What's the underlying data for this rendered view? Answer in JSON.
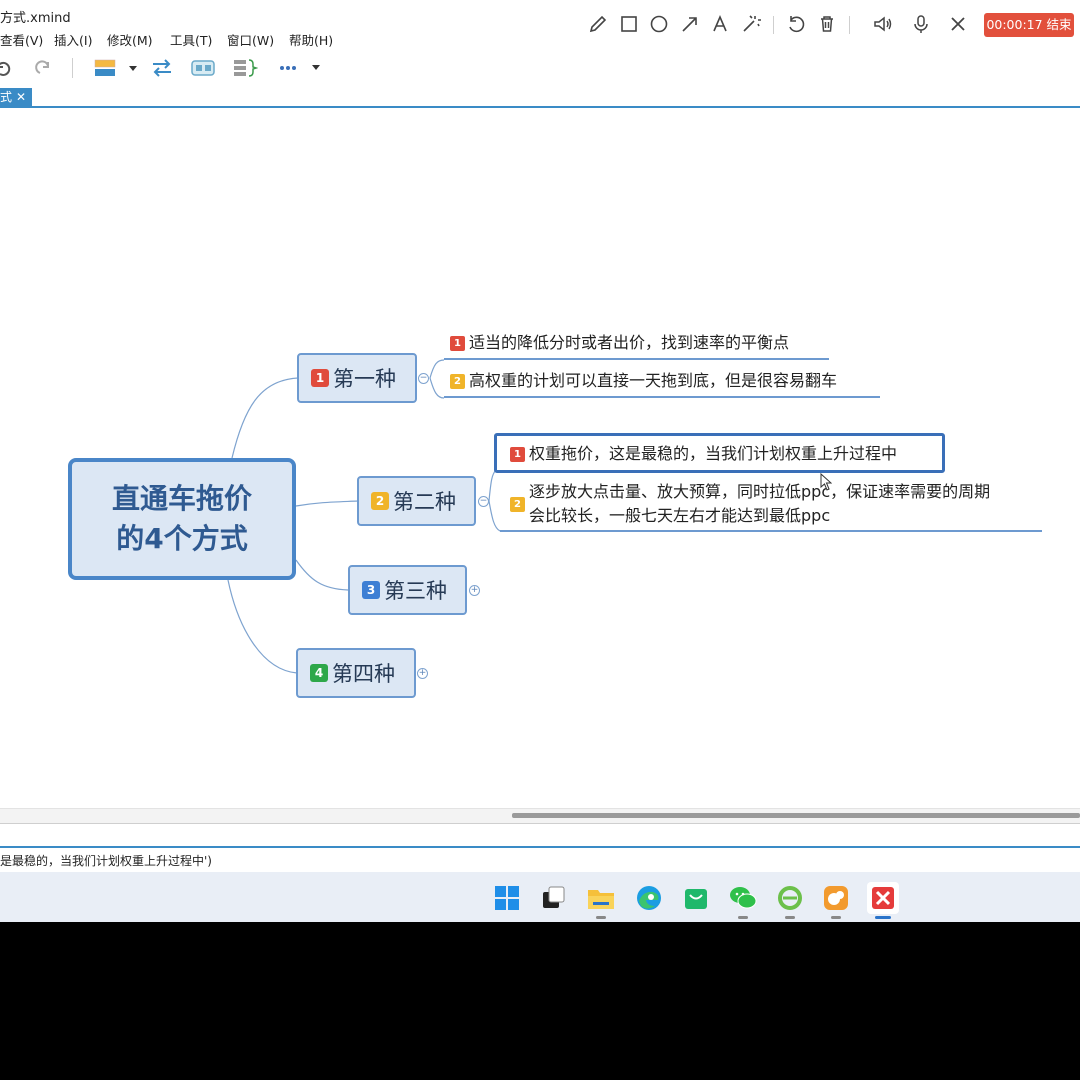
{
  "window": {
    "title": "方式.xmind"
  },
  "menu": {
    "items": [
      {
        "label": "查看(V)"
      },
      {
        "label": "插入(I)"
      },
      {
        "label": "修改(M)"
      },
      {
        "label": "工具(T)"
      },
      {
        "label": "窗口(W)"
      },
      {
        "label": "帮助(H)"
      }
    ]
  },
  "recorder": {
    "icons": [
      "pencil-icon",
      "rectangle-icon",
      "circle-icon",
      "arrow-icon",
      "text-icon",
      "magic-wand-icon",
      "undo-icon",
      "trash-icon",
      "speaker-icon",
      "microphone-icon",
      "close-icon"
    ],
    "timer_label": "00:00:17 结束",
    "timer_color": "#e2503c"
  },
  "toolbar": {
    "icons": [
      "undo-icon",
      "redo-icon",
      "insert-topic-icon",
      "relationship-icon",
      "boundary-icon",
      "summary-icon",
      "more-icon"
    ]
  },
  "tab": {
    "label": "式",
    "close": "✕"
  },
  "mindmap": {
    "central": {
      "line1": "直通车拖价",
      "line2": "的4个方式"
    },
    "topics": [
      {
        "badge": "1",
        "label": "第一种",
        "children": [
          {
            "badge": "1",
            "text": "适当的降低分时或者出价，找到速率的平衡点"
          },
          {
            "badge": "2",
            "text": "高权重的计划可以直接一天拖到底，但是很容易翻车"
          }
        ]
      },
      {
        "badge": "2",
        "label": "第二种",
        "children": [
          {
            "badge": "1",
            "text": "权重拖价，这是最稳的，当我们计划权重上升过程中"
          },
          {
            "badge": "2",
            "line1": "逐步放大点击量、放大预算，同时拉低ppc，保证速率需要的周期",
            "line2": "会比较长，一般七天左右才能达到最低ppc"
          }
        ]
      },
      {
        "badge": "3",
        "label": "第三种"
      },
      {
        "badge": "4",
        "label": "第四种"
      }
    ],
    "colors": {
      "topic_fill": "#dce7f4",
      "topic_border": "#6d9ad0",
      "central_border": "#4a86c8",
      "central_text": "#2f5a91"
    }
  },
  "status": {
    "text": "是最稳的，当我们计划权重上升过程中')"
  },
  "taskbar": {
    "apps": [
      "windows-start-icon",
      "task-view-icon",
      "file-explorer-icon",
      "edge-browser-icon",
      "store-icon",
      "wechat-icon",
      "ie-browser-icon",
      "uc-browser-icon",
      "xmind-icon"
    ]
  }
}
